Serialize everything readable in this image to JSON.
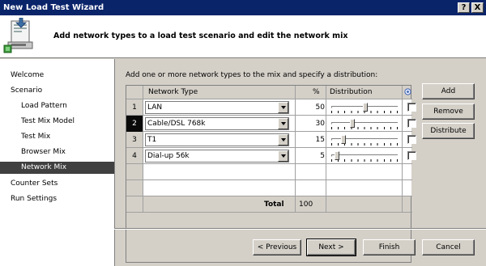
{
  "window": {
    "title": "New Load Test Wizard",
    "help_button": "?",
    "close_button": "X"
  },
  "header": {
    "text": "Add network types to a load test scenario and edit the network mix",
    "icon": "wizard-network-icon"
  },
  "nav": {
    "items": [
      {
        "label": "Welcome",
        "level": 0
      },
      {
        "label": "Scenario",
        "level": 0
      },
      {
        "label": "Load Pattern",
        "level": 1
      },
      {
        "label": "Test Mix Model",
        "level": 1
      },
      {
        "label": "Test Mix",
        "level": 1
      },
      {
        "label": "Browser Mix",
        "level": 1
      },
      {
        "label": "Network Mix",
        "level": 1,
        "selected": true
      },
      {
        "label": "Counter Sets",
        "level": 0
      },
      {
        "label": "Run Settings",
        "level": 0
      }
    ]
  },
  "content": {
    "instruction": "Add one or more network types to the mix and specify a distribution:",
    "columns": {
      "network_type": "Network Type",
      "percent": "%",
      "distribution": "Distribution",
      "lock_icon": "lock-icon"
    },
    "rows": [
      {
        "num": "1",
        "network": "LAN",
        "percent": "50",
        "slider": 0.5,
        "locked": false
      },
      {
        "num": "2",
        "network": "Cable/DSL 768k",
        "percent": "30",
        "slider": 0.3,
        "locked": false,
        "selected": true
      },
      {
        "num": "3",
        "network": "T1",
        "percent": "15",
        "slider": 0.15,
        "locked": false
      },
      {
        "num": "4",
        "network": "Dial-up 56k",
        "percent": "5",
        "slider": 0.05,
        "locked": false
      }
    ],
    "total_label": "Total",
    "total_value": "100",
    "buttons": {
      "add": "Add",
      "remove": "Remove",
      "distribute": "Distribute"
    }
  },
  "footer": {
    "previous": "< Previous",
    "next": "Next >",
    "finish": "Finish",
    "cancel": "Cancel"
  },
  "colors": {
    "titlebar": "#0a246a",
    "face": "#d4d0c8",
    "selected_nav": "#404040"
  }
}
